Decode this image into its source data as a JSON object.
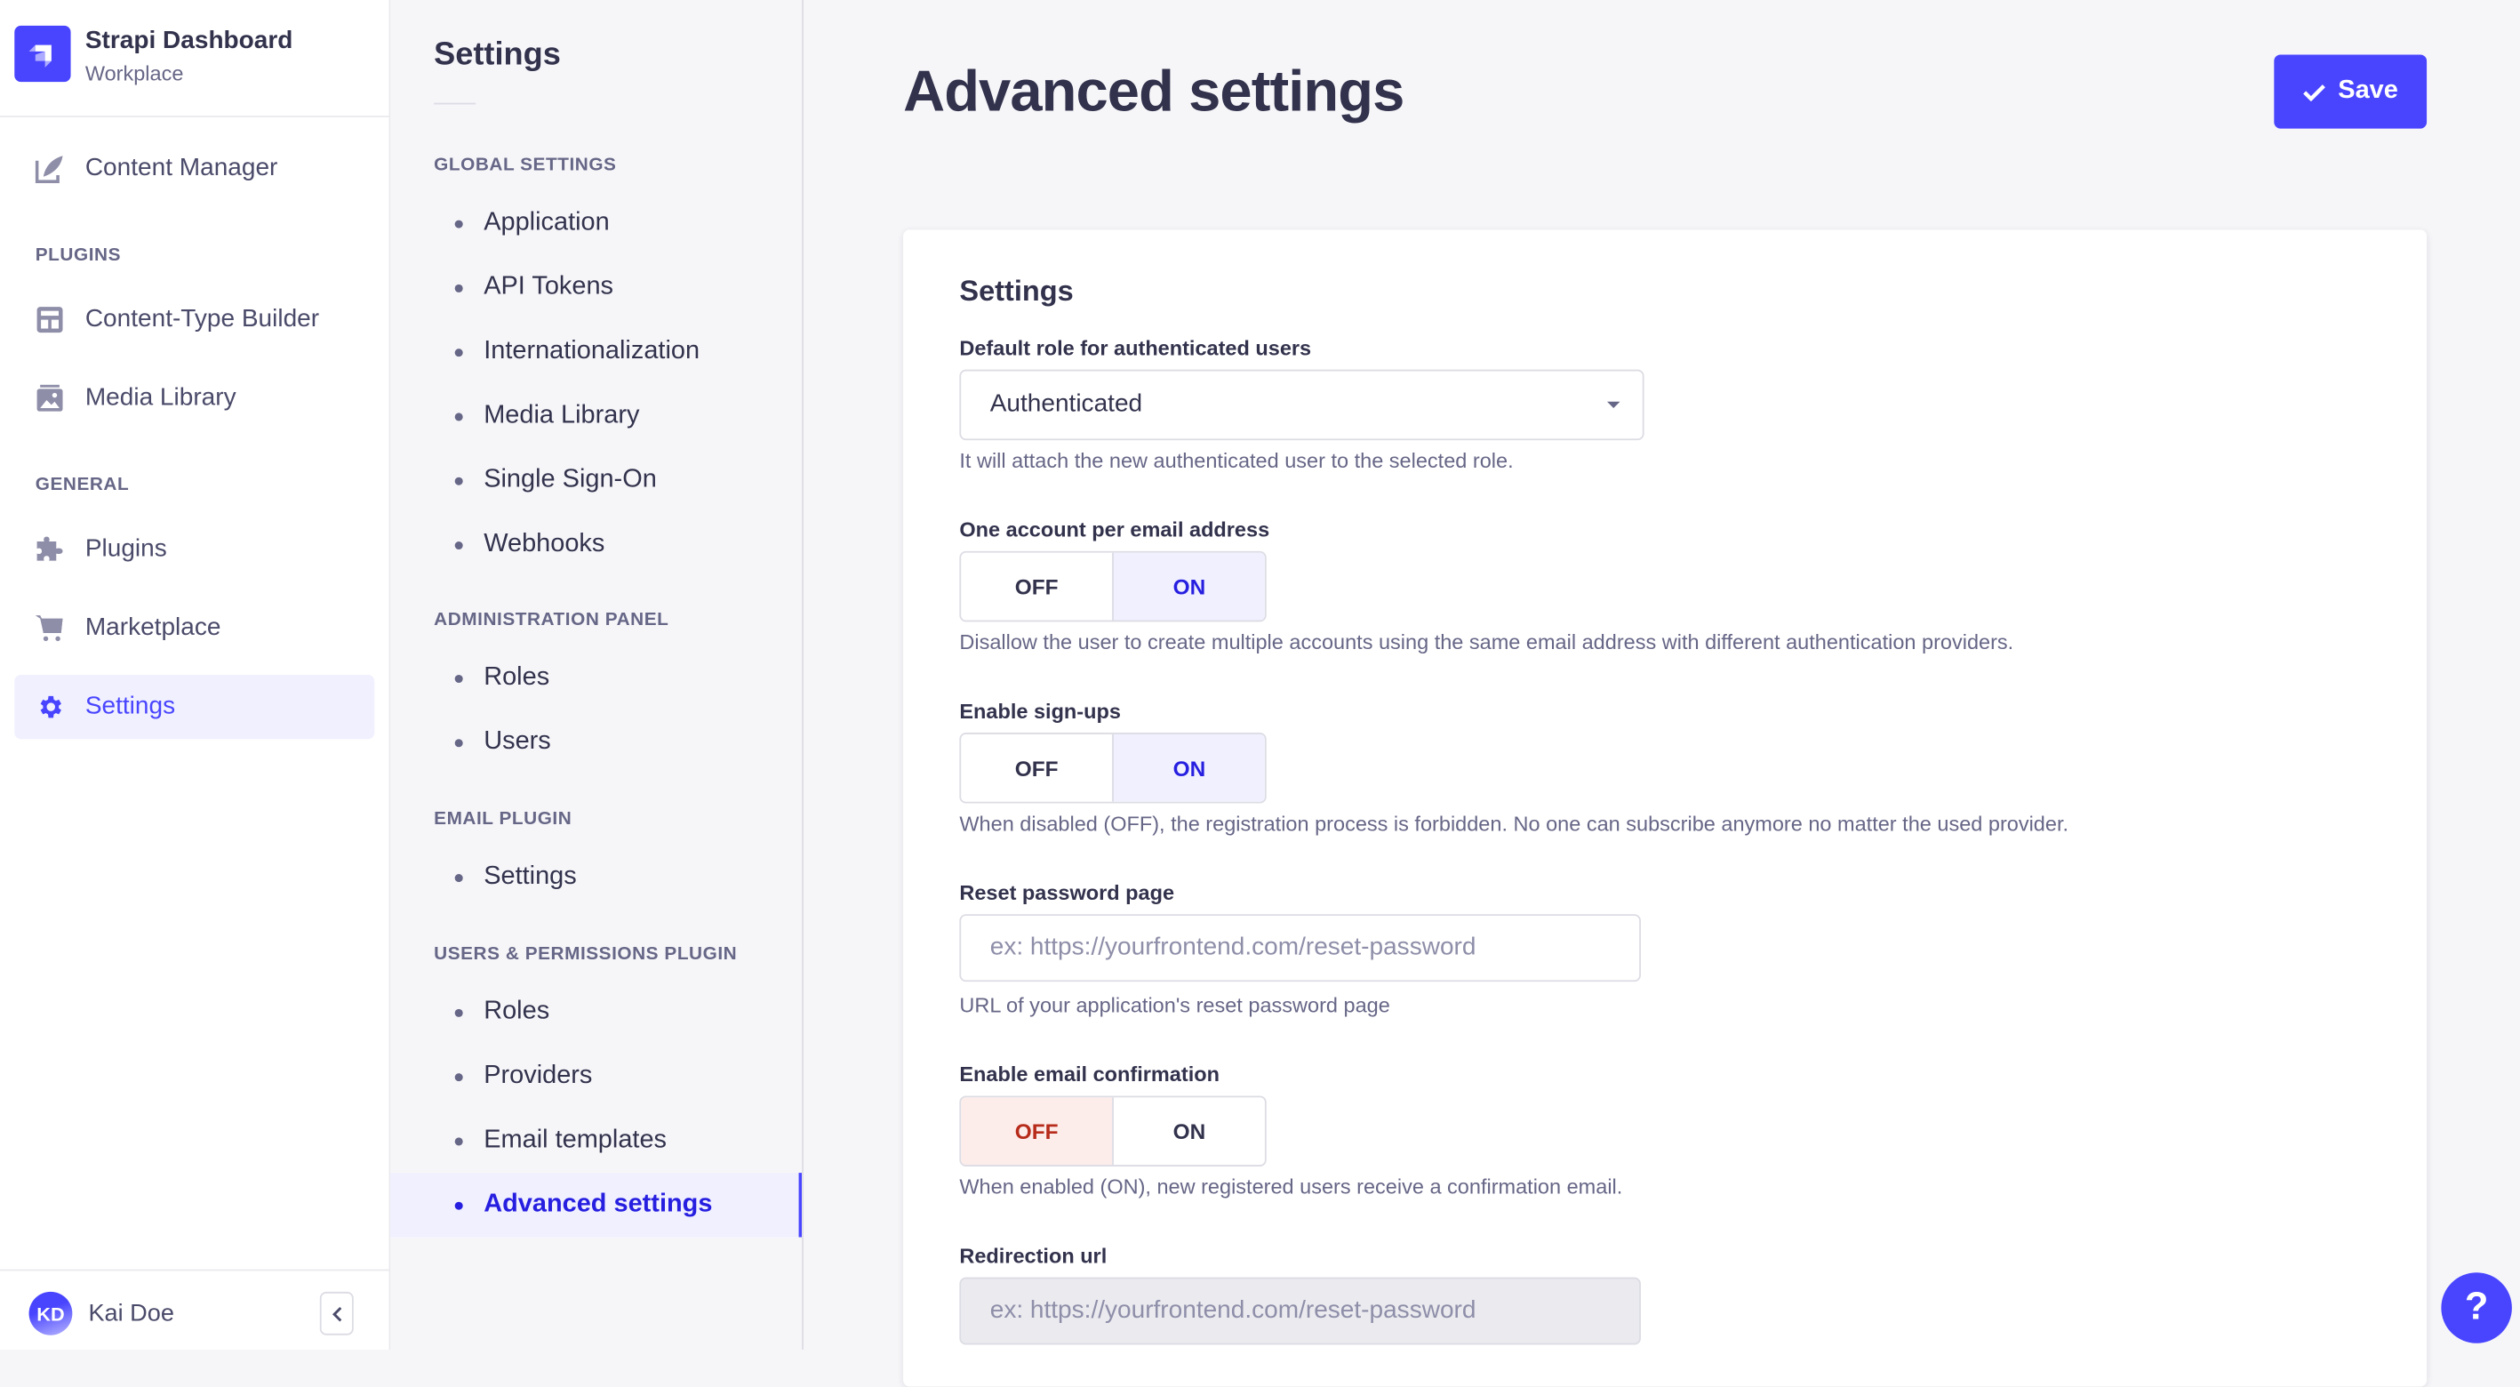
{
  "brand": {
    "title": "Strapi Dashboard",
    "subtitle": "Workplace"
  },
  "main_nav": {
    "content_manager": {
      "label": "Content Manager",
      "icon": "feather-icon"
    },
    "sections": {
      "plugins": "PLUGINS",
      "general": "GENERAL"
    },
    "plugins": [
      {
        "label": "Content-Type Builder",
        "icon": "layout-icon"
      },
      {
        "label": "Media Library",
        "icon": "image-icon"
      }
    ],
    "general": [
      {
        "label": "Plugins",
        "icon": "puzzle-icon"
      },
      {
        "label": "Marketplace",
        "icon": "cart-icon"
      },
      {
        "label": "Settings",
        "icon": "gear-icon",
        "active": true
      }
    ],
    "user": {
      "initials": "KD",
      "name": "Kai Doe"
    }
  },
  "sub_nav": {
    "title": "Settings",
    "sections": [
      {
        "title": "GLOBAL SETTINGS",
        "items": [
          "Application",
          "API Tokens",
          "Internationalization",
          "Media Library",
          "Single Sign-On",
          "Webhooks"
        ]
      },
      {
        "title": "ADMINISTRATION PANEL",
        "items": [
          "Roles",
          "Users"
        ]
      },
      {
        "title": "EMAIL PLUGIN",
        "items": [
          "Settings"
        ]
      },
      {
        "title": "USERS & PERMISSIONS PLUGIN",
        "items": [
          "Roles",
          "Providers",
          "Email templates",
          "Advanced settings"
        ]
      }
    ],
    "active_item": "Advanced settings"
  },
  "page": {
    "title": "Advanced settings",
    "save_label": "Save",
    "card_title": "Settings",
    "fields": {
      "default_role": {
        "label": "Default role for authenticated users",
        "value": "Authenticated",
        "hint": "It will attach the new authenticated user to the selected role."
      },
      "unique_email": {
        "label": "One account per email address",
        "off": "OFF",
        "on": "ON",
        "value": "ON",
        "hint": "Disallow the user to create multiple accounts using the same email address with different authentication providers."
      },
      "allow_register": {
        "label": "Enable sign-ups",
        "off": "OFF",
        "on": "ON",
        "value": "ON",
        "hint": "When disabled (OFF), the registration process is forbidden. No one can subscribe anymore no matter the used provider."
      },
      "reset_password": {
        "label": "Reset password page",
        "value": "",
        "placeholder": "ex: https://yourfrontend.com/reset-password",
        "hint": "URL of your application's reset password page"
      },
      "email_confirmation": {
        "label": "Enable email confirmation",
        "off": "OFF",
        "on": "ON",
        "value": "OFF",
        "hint": "When enabled (ON), new registered users receive a confirmation email."
      },
      "redirection_url": {
        "label": "Redirection url",
        "value": "",
        "placeholder": "ex: https://yourfrontend.com/reset-password",
        "disabled": true
      }
    }
  },
  "help": {
    "label": "?"
  },
  "colors": {
    "primary": "#4945ff",
    "primary_text": "#271fe0",
    "danger_text": "#b72b1a",
    "danger_bg": "#fcecea",
    "selected_bg": "#f0f0ff"
  }
}
